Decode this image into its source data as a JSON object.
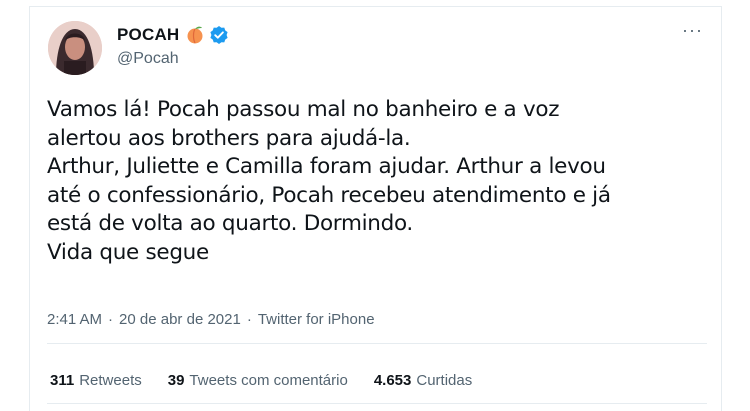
{
  "user": {
    "display_name": "POCAH",
    "handle": "@Pocah",
    "emoji_icon": "peach-icon",
    "verified_icon": "verified-badge-icon",
    "avatar_icon": "profile-photo-avatar"
  },
  "more_label": "···",
  "tweet": {
    "lines": [
      "Vamos lá! Pocah passou mal no banheiro e a voz",
      "alertou aos brothers para ajudá-la.",
      "Arthur, Juliette e Camilla foram ajudar. Arthur a levou",
      "até o confessionário, Pocah recebeu atendimento e já",
      "está de volta ao quarto. Dormindo.",
      "Vida que segue"
    ]
  },
  "meta": {
    "time": "2:41 AM",
    "date": "20 de abr de 2021",
    "source": "Twitter for iPhone",
    "separator": "·"
  },
  "stats": {
    "retweets_count": "311",
    "retweets_label": "Retweets",
    "quotes_count": "39",
    "quotes_label": "Tweets com comentário",
    "likes_count": "4.653",
    "likes_label": "Curtidas"
  },
  "colors": {
    "text": "#0f1419",
    "secondary": "#536471",
    "verified": "#1d9bf0",
    "divider": "#e6ecf0"
  }
}
